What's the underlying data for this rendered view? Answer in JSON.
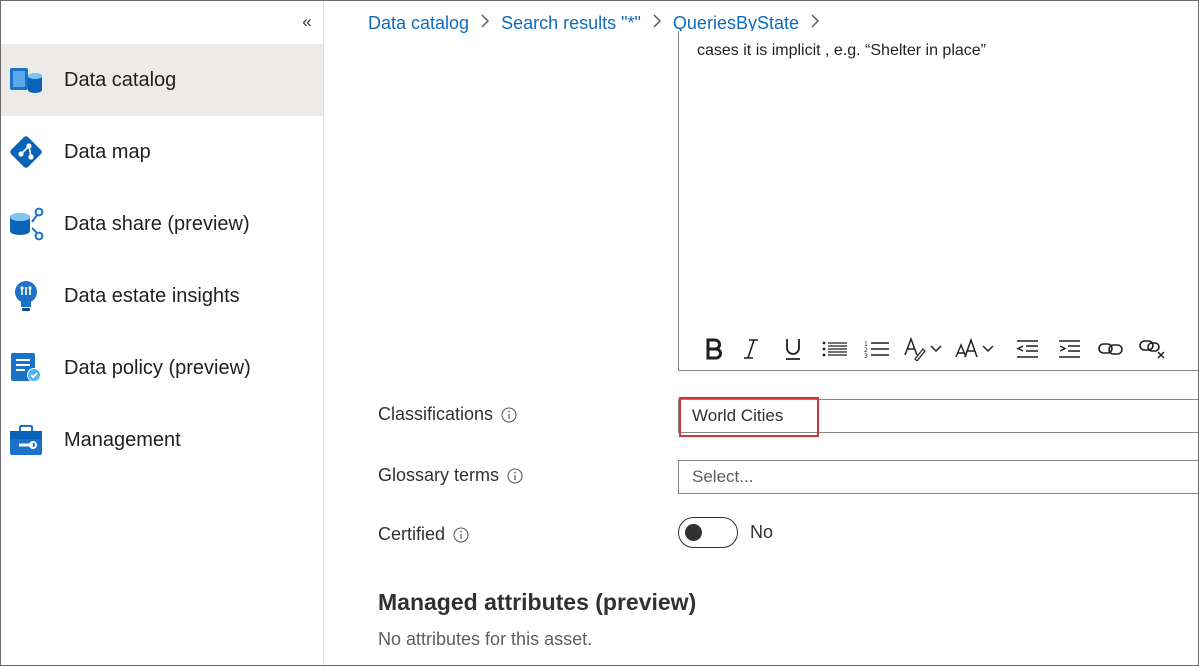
{
  "sidebar": {
    "collapse_glyph": "«",
    "items": [
      {
        "label": "Data catalog",
        "icon": "data-catalog-icon",
        "active": true
      },
      {
        "label": "Data map",
        "icon": "data-map-icon",
        "active": false
      },
      {
        "label": "Data share (preview)",
        "icon": "data-share-icon",
        "active": false
      },
      {
        "label": "Data estate insights",
        "icon": "lightbulb-icon",
        "active": false
      },
      {
        "label": "Data policy (preview)",
        "icon": "data-policy-icon",
        "active": false
      },
      {
        "label": "Management",
        "icon": "toolbox-icon",
        "active": false
      }
    ]
  },
  "breadcrumb": {
    "items": [
      "Data catalog",
      "Search results \"*\"",
      "QueriesByState"
    ]
  },
  "editor": {
    "text": "cases it is implicit , e.g. “Shelter in place”",
    "toolbar": [
      "bold",
      "italic",
      "underline",
      "bullet-list",
      "numbered-list",
      "font-color",
      "font-size",
      "decrease-indent",
      "increase-indent",
      "insert-link",
      "remove-link"
    ]
  },
  "form": {
    "classifications": {
      "label": "Classifications",
      "value": "World Cities"
    },
    "glossary": {
      "label": "Glossary terms",
      "placeholder": "Select..."
    },
    "certified": {
      "label": "Certified",
      "state": "No",
      "on": false
    }
  },
  "managed_attributes": {
    "title": "Managed attributes (preview)",
    "empty_text": "No attributes for this asset."
  },
  "colors": {
    "link": "#0f6cbd",
    "active_bg": "#edebe9",
    "highlight_border": "#d13438",
    "icon_blue": "#0078d4"
  }
}
